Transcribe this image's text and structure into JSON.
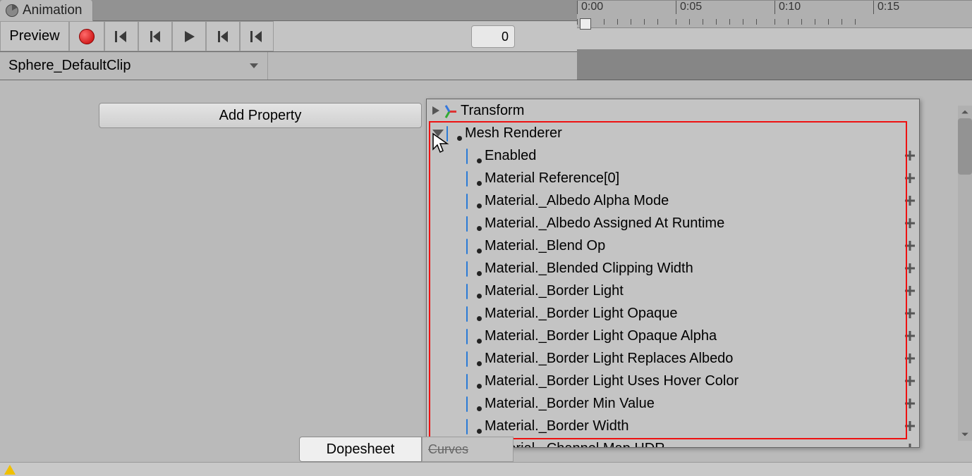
{
  "tab": {
    "title": "Animation"
  },
  "toolbar": {
    "preview_label": "Preview",
    "frame_value": "0"
  },
  "clipbar": {
    "clip_name": "Sphere_DefaultClip"
  },
  "timeline": {
    "marks": [
      "0:00",
      "0:05",
      "0:10",
      "0:15"
    ]
  },
  "add_property_label": "Add Property",
  "property_popup": {
    "transform_label": "Transform",
    "mesh_renderer_label": "Mesh Renderer",
    "items": [
      "Enabled",
      "Material Reference[0]",
      "Material._Albedo Alpha Mode",
      "Material._Albedo Assigned At Runtime",
      "Material._Blend Op",
      "Material._Blended Clipping Width",
      "Material._Border Light",
      "Material._Border Light Opaque",
      "Material._Border Light Opaque Alpha",
      "Material._Border Light Replaces Albedo",
      "Material._Border Light Uses Hover Color",
      "Material._Border Min Value",
      "Material._Border Width",
      "Material._Channel Map HDR"
    ]
  },
  "footer": {
    "dopesheet_label": "Dopesheet",
    "curves_label": "Curves"
  }
}
